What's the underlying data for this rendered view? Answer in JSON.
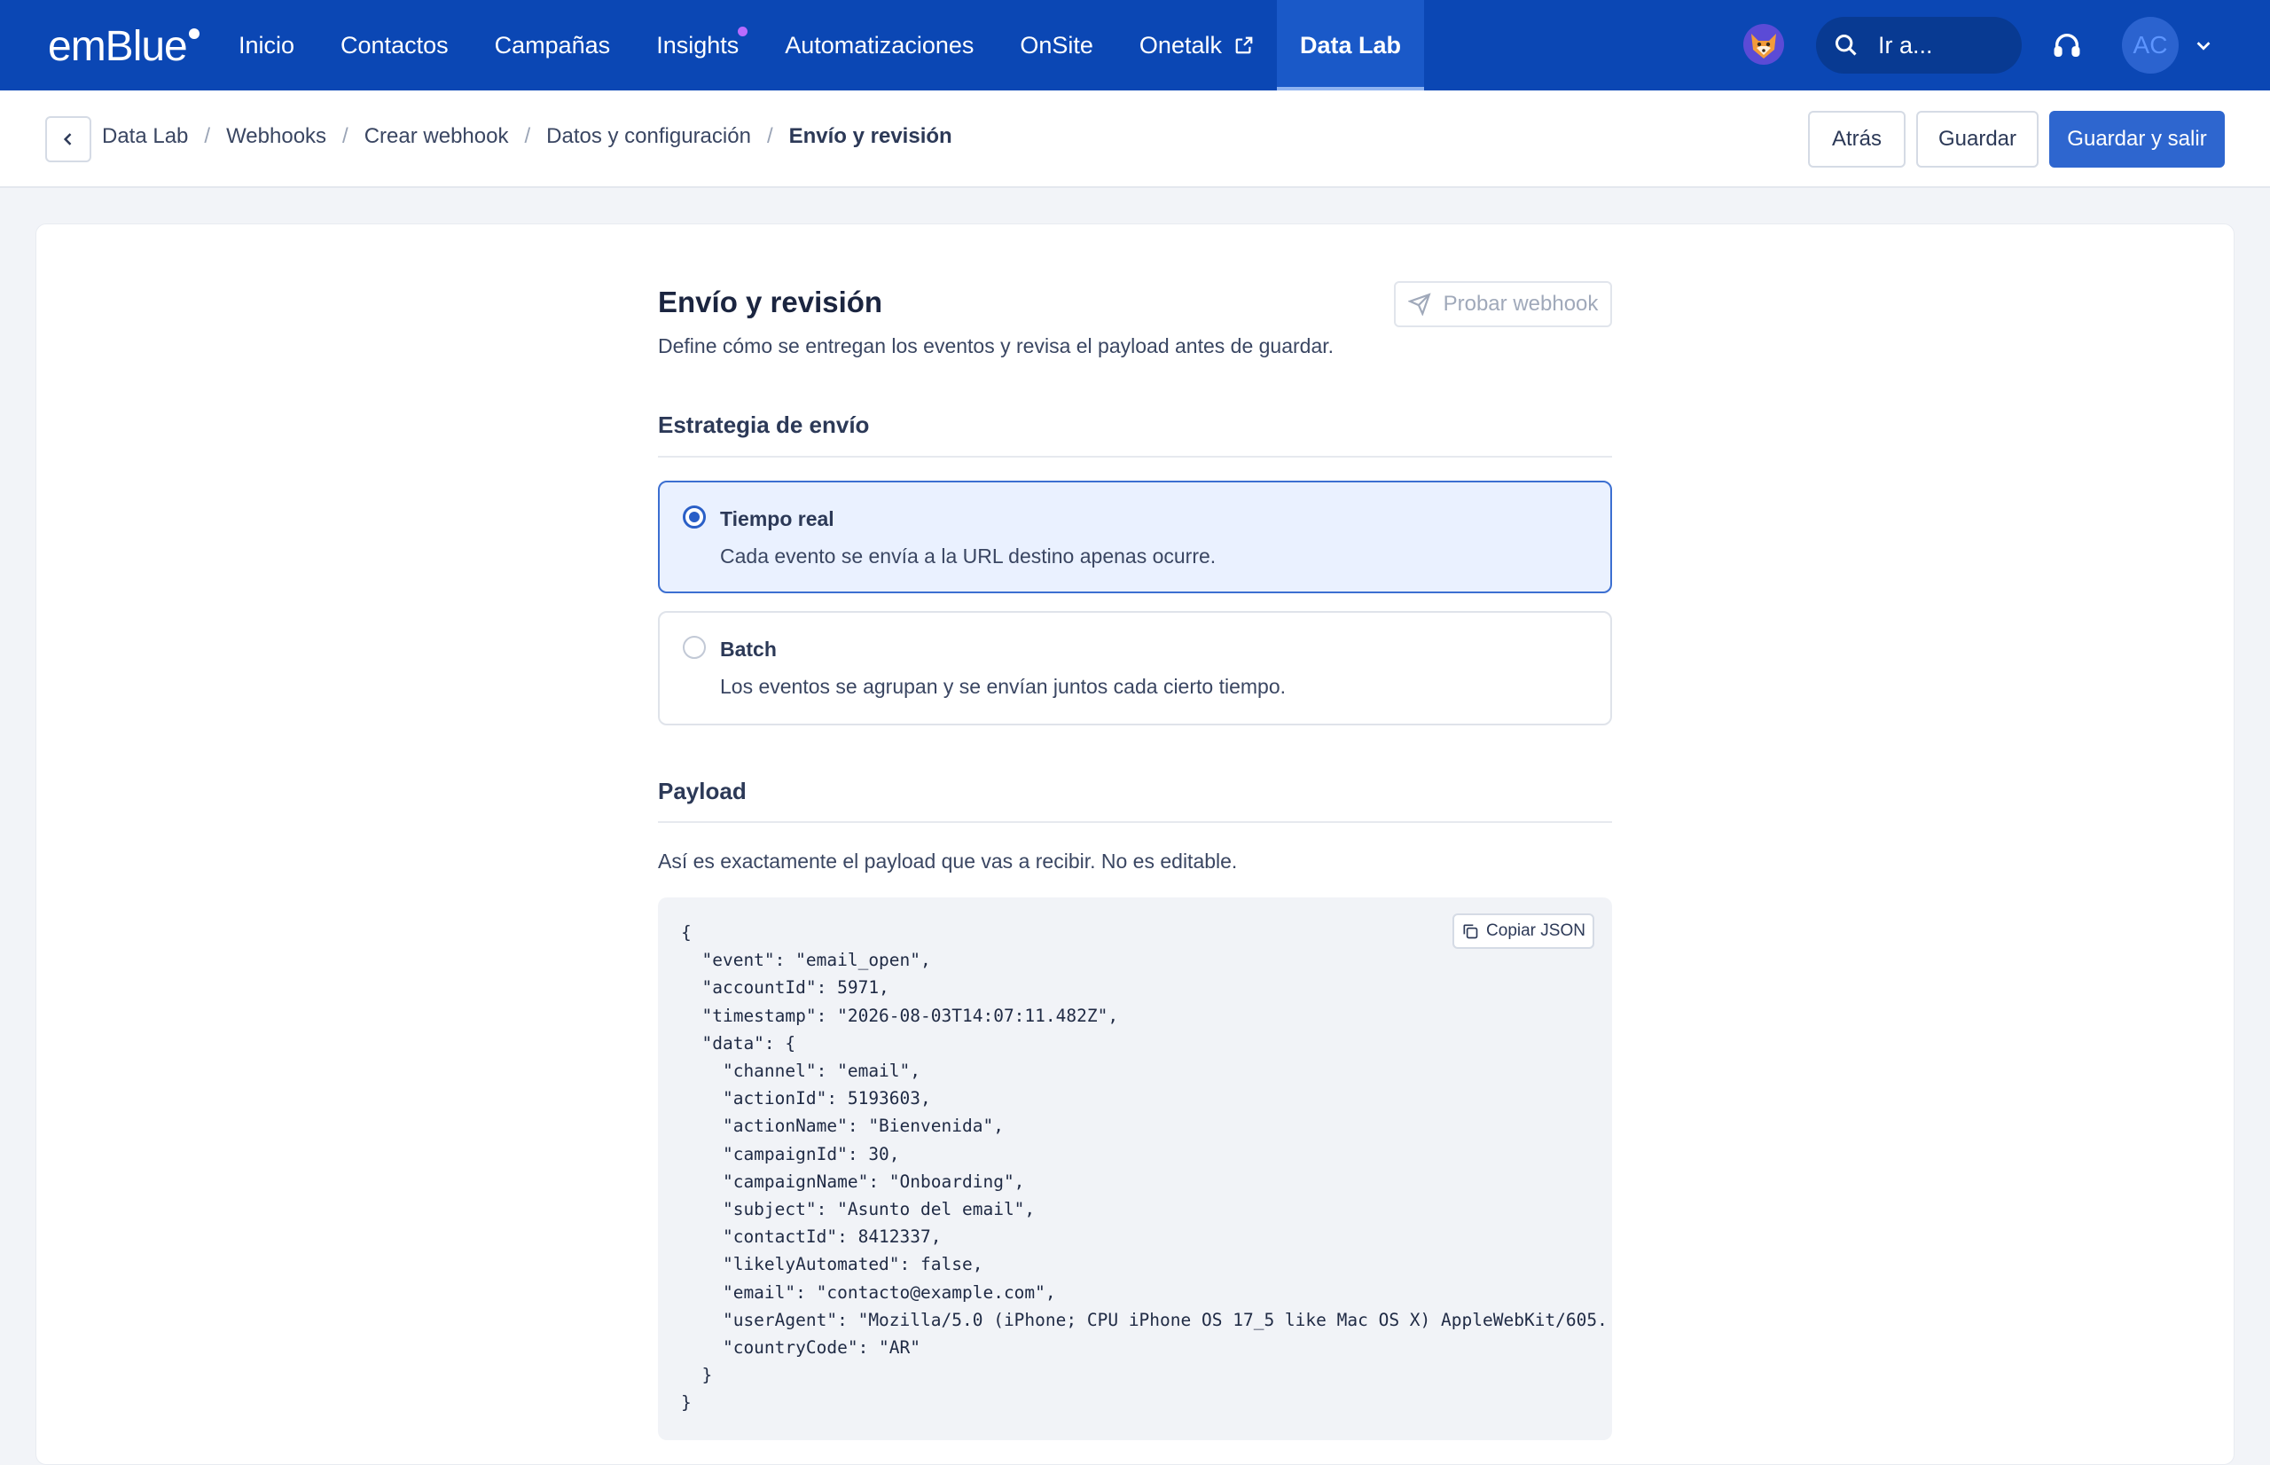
{
  "brand": {
    "logo_text": "emBlue"
  },
  "nav": {
    "items": [
      {
        "label": "Inicio"
      },
      {
        "label": "Contactos"
      },
      {
        "label": "Campañas"
      },
      {
        "label": "Insights"
      },
      {
        "label": "Automatizaciones"
      },
      {
        "label": "OnSite"
      },
      {
        "label": "Onetalk"
      },
      {
        "label": "Data Lab"
      }
    ],
    "active": "Data Lab",
    "search_placeholder": "Ir a...",
    "avatar_initials": "AC"
  },
  "breadcrumb": {
    "items": [
      "Data Lab",
      "Webhooks",
      "Crear webhook",
      "Datos y configuración",
      "Envío y revisión"
    ],
    "separator": "/"
  },
  "actions": {
    "back": "Atrás",
    "save": "Guardar",
    "save_exit": "Guardar y salir"
  },
  "page": {
    "title": "Envío y revisión",
    "subtitle": "Define cómo se entregan los eventos y revisa el payload antes de guardar.",
    "test_button": "Probar webhook"
  },
  "strategy": {
    "heading": "Estrategia de envío",
    "options": [
      {
        "title": "Tiempo real",
        "desc": "Cada evento se envía a la URL destino apenas ocurre.",
        "selected": true
      },
      {
        "title": "Batch",
        "desc": "Los eventos se agrupan y se envían juntos cada cierto tiempo.",
        "selected": false
      }
    ]
  },
  "payload": {
    "heading": "Payload",
    "note": "Así es exactamente el payload que vas a recibir. No es editable.",
    "copy_label": "Copiar JSON",
    "code": "{\n  \"event\": \"email_open\",\n  \"accountId\": 5971,\n  \"timestamp\": \"2026-08-03T14:07:11.482Z\",\n  \"data\": {\n    \"channel\": \"email\",\n    \"actionId\": 5193603,\n    \"actionName\": \"Bienvenida\",\n    \"campaignId\": 30,\n    \"campaignName\": \"Onboarding\",\n    \"subject\": \"Asunto del email\",\n    \"contactId\": 8412337,\n    \"likelyAutomated\": false,\n    \"email\": \"contacto@example.com\",\n    \"userAgent\": \"Mozilla/5.0 (iPhone; CPU iPhone OS 17_5 like Mac OS X) AppleWebKit/605.\n    \"countryCode\": \"AR\"\n  }\n}"
  },
  "colors": {
    "nav_bg": "#0b47b4",
    "primary": "#2e66cf",
    "selected_bg": "#eaf1ff"
  }
}
